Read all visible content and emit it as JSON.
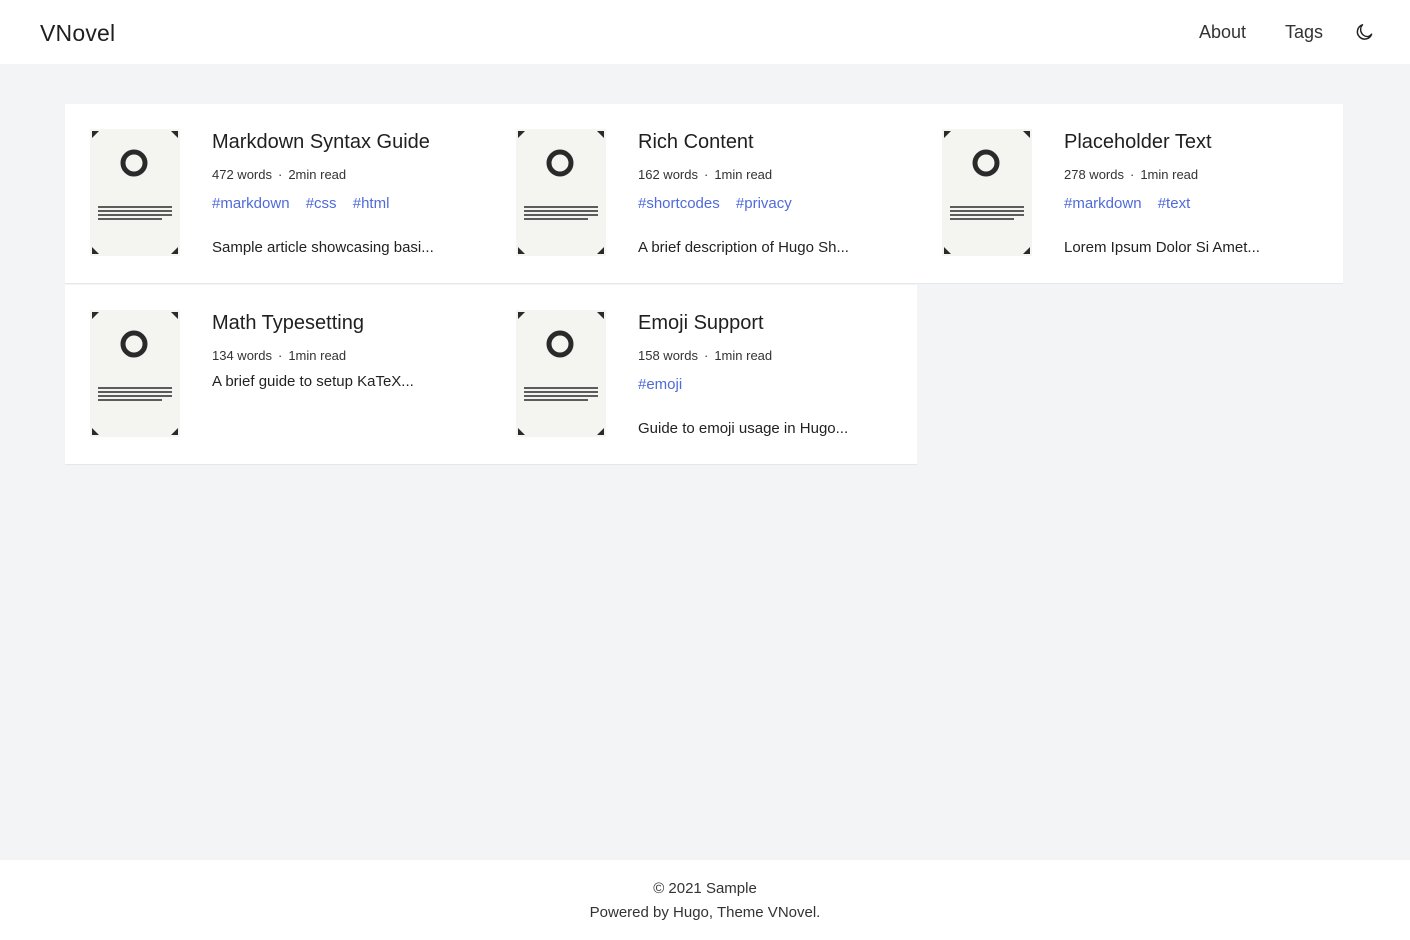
{
  "header": {
    "brand": "VNovel",
    "nav": [
      {
        "label": "About"
      },
      {
        "label": "Tags"
      }
    ],
    "theme_toggle_icon": "moon-icon"
  },
  "posts": [
    {
      "title": "Markdown Syntax Guide",
      "words": "472 words",
      "read": "2min read",
      "tags": [
        "#markdown",
        "#css",
        "#html"
      ],
      "summary": "Sample article showcasing basi..."
    },
    {
      "title": "Rich Content",
      "words": "162 words",
      "read": "1min read",
      "tags": [
        "#shortcodes",
        "#privacy"
      ],
      "summary": "A brief description of Hugo Sh..."
    },
    {
      "title": "Placeholder Text",
      "words": "278 words",
      "read": "1min read",
      "tags": [
        "#markdown",
        "#text"
      ],
      "summary": "Lorem Ipsum Dolor Si Amet..."
    },
    {
      "title": "Math Typesetting",
      "words": "134 words",
      "read": "1min read",
      "tags": [],
      "summary": "A brief guide to setup KaTeX..."
    },
    {
      "title": "Emoji Support",
      "words": "158 words",
      "read": "1min read",
      "tags": [
        "#emoji"
      ],
      "summary": "Guide to emoji usage in Hugo..."
    }
  ],
  "footer": {
    "copyright": "© 2021 Sample",
    "powered": "Powered by Hugo, Theme VNovel."
  },
  "colors": {
    "background": "#f3f4f6",
    "surface": "#ffffff",
    "tag_link": "#4f6bd8",
    "text": "#222222"
  }
}
